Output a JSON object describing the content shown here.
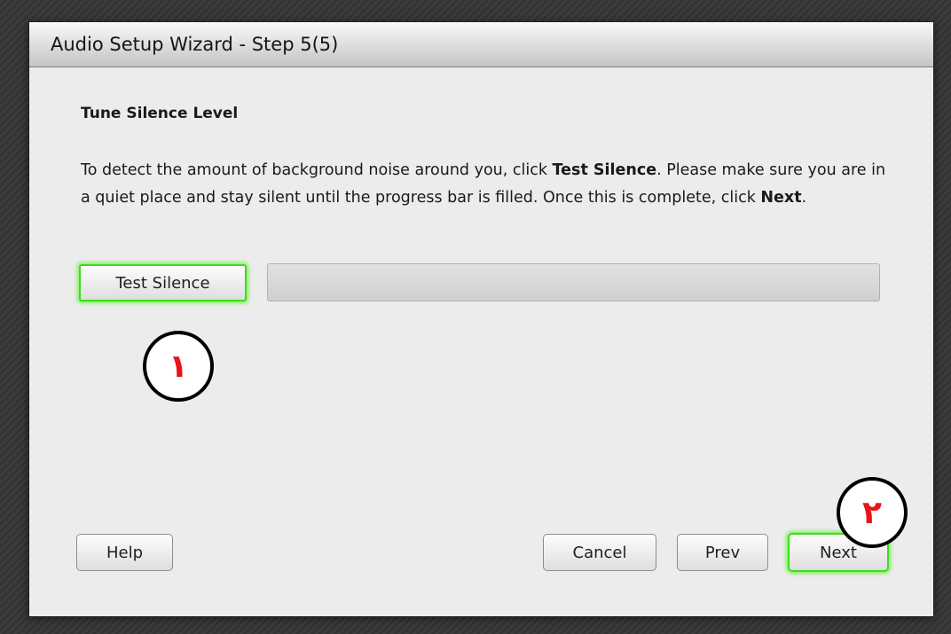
{
  "window": {
    "title": "Audio Setup Wizard - Step 5(5)"
  },
  "content": {
    "heading": "Tune Silence Level",
    "instructions": {
      "part1": "To detect the amount of background noise around you, click ",
      "test_silence": "Test Silence",
      "part2": ". Please make sure you are in a quiet place and stay silent until the progress bar is filled. Once this is complete, click ",
      "next": "Next",
      "part3": "."
    }
  },
  "test": {
    "button_label": "Test Silence",
    "progress": 0
  },
  "buttons": {
    "help": "Help",
    "cancel": "Cancel",
    "prev": "Prev",
    "next": "Next"
  },
  "annotations": {
    "marker_1": "١",
    "marker_2": "٢"
  },
  "colors": {
    "highlight_glow": "#3cdc1c",
    "annotation_digit": "#e8141c"
  }
}
